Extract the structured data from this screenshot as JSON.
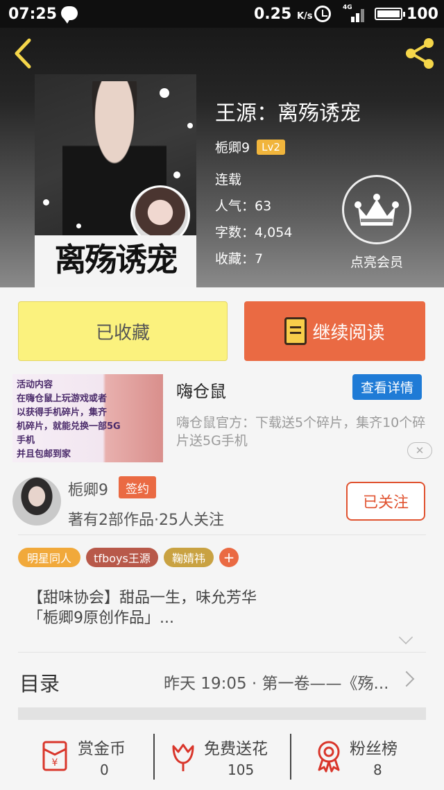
{
  "status_bar": {
    "time": "07:25",
    "speed": "0.25",
    "speed_unit": "K/s",
    "network": "4G",
    "battery": "100"
  },
  "book": {
    "title": "王源：离殇诱宠",
    "cover_text": "离殇诱宠",
    "author": "栀卿9",
    "level": "Lv2",
    "status": "连载",
    "popularity": "人气：63",
    "word_count": "字数：4,054",
    "favorites": "收藏：7"
  },
  "vip": {
    "label": "点亮会员"
  },
  "actions": {
    "favorited_label": "已收藏",
    "continue_label": "继续阅读"
  },
  "ad": {
    "image_text": [
      "活动内容",
      "在嗨仓鼠上玩游戏或者",
      "以获得手机碎片，集齐",
      "机碎片，就能兑换一部5G手机",
      "并且包邮到家"
    ],
    "title": "嗨仓鼠",
    "button": "查看详情",
    "description": "嗨仓鼠官方：下载送5个碎片，集齐10个碎片送5G手机",
    "close": "✕"
  },
  "author_card": {
    "name": "栀卿9",
    "badge": "签约",
    "stats": "著有2部作品·25人关注",
    "follow_label": "已关注"
  },
  "tags": [
    {
      "label": "明星同人",
      "color": "#f1a93b"
    },
    {
      "label": "tfboys王源",
      "color": "#b8594a"
    },
    {
      "label": "鞠婧祎",
      "color": "#c9a242"
    }
  ],
  "tag_add": "+",
  "description_lines": [
    "【甜味协会】甜品一生，味允芳华",
    "「栀卿9原创作品」..."
  ],
  "toc": {
    "label": "目录",
    "latest": "昨天 19:05 · 第一卷——《殇..."
  },
  "bottom_bar": [
    {
      "label": "赏金币",
      "value": "0",
      "icon": "red-envelope-icon"
    },
    {
      "label": "免费送花",
      "value": "105",
      "icon": "flower-icon"
    },
    {
      "label": "粉丝榜",
      "value": "8",
      "icon": "medal-icon"
    }
  ],
  "colors": {
    "accent": "#ea6a43",
    "fav_button": "#fbf27e",
    "ad_button": "#1f7bd6",
    "icon_red": "#d9362b"
  }
}
